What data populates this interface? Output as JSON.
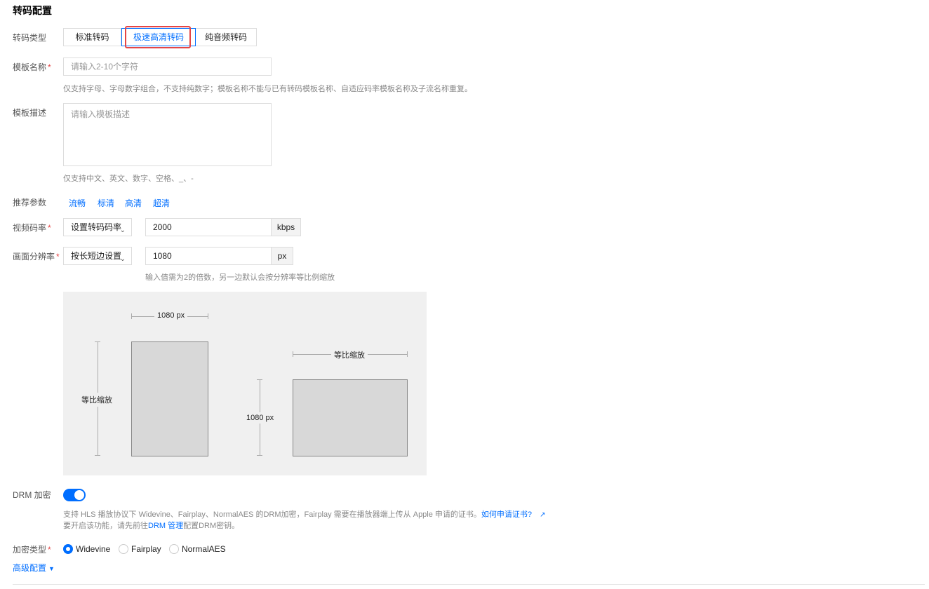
{
  "section_title": "转码配置",
  "transcode_type": {
    "label": "转码类型",
    "options": [
      "标准转码",
      "极速高清转码",
      "纯音频转码"
    ],
    "selected": "极速高清转码"
  },
  "template_name": {
    "label": "模板名称",
    "placeholder": "请输入2-10个字符",
    "hint": "仅支持字母、字母数字组合，不支持纯数字；模板名称不能与已有转码模板名称、自适应码率模板名称及子流名称重复。"
  },
  "template_desc": {
    "label": "模板描述",
    "placeholder": "请输入模板描述",
    "hint": "仅支持中文、英文、数字、空格、_、-"
  },
  "recommended": {
    "label": "推荐参数",
    "options": [
      "流畅",
      "标清",
      "高清",
      "超清"
    ]
  },
  "video_bitrate": {
    "label": "视频码率",
    "select_value": "设置转码码率",
    "value": "2000",
    "unit": "kbps"
  },
  "resolution": {
    "label": "画面分辨率",
    "select_value": "按长短边设置",
    "value": "1080",
    "unit": "px",
    "hint": "输入值需为2的倍数，另一边默认会按分辨率等比例缩放"
  },
  "diagram": {
    "top_width": "1080 px",
    "left_height": "等比缩放",
    "right_width": "等比缩放",
    "right_height": "1080 px"
  },
  "drm": {
    "label": "DRM 加密",
    "enabled": true,
    "desc_part1": "支持 HLS 播放协议下 Widevine、Fairplay、NormalAES 的DRM加密，Fairplay 需要在播放器端上传从 Apple 申请的证书。",
    "cert_link": "如何申请证书?",
    "desc2_part1": "要开启该功能，请先前往",
    "drm_manage_link": "DRM 管理",
    "desc2_part2": "配置DRM密钥。"
  },
  "encrypt_type": {
    "label": "加密类型",
    "options": [
      "Widevine",
      "Fairplay",
      "NormalAES"
    ],
    "selected": "Widevine"
  },
  "advanced": {
    "label": "高级配置"
  },
  "colors": {
    "primary": "#006eff",
    "required": "#e54545",
    "highlight_border": "#e54545"
  }
}
